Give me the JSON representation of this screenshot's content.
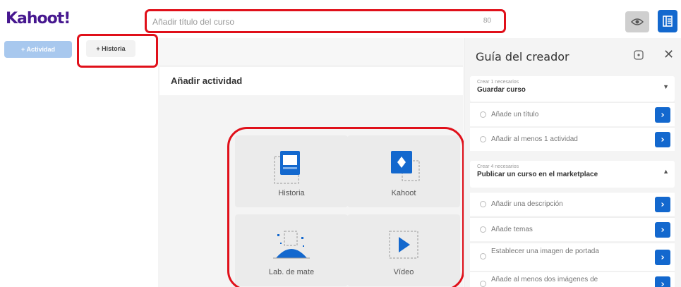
{
  "app": {
    "logo": "Kahoot!"
  },
  "header": {
    "title_placeholder": "Añadir título del curso",
    "title_counter": "80"
  },
  "left": {
    "activity_button": "+ Actividad",
    "story_button": "+ Historia"
  },
  "main": {
    "add_activity_title": "Añadir actividad",
    "tiles": [
      {
        "label": "Historia",
        "icon": "story-icon"
      },
      {
        "label": "Kahoot",
        "icon": "kahoot-icon"
      },
      {
        "label": "Lab. de mate",
        "icon": "math-lab-icon"
      },
      {
        "label": "Vídeo",
        "icon": "video-icon"
      }
    ]
  },
  "panel": {
    "title": "Guía del creador",
    "groups": [
      {
        "small": "Crear 1 necesarios",
        "title": "Guardar curso",
        "tasks": [
          "Añade un título",
          "Añadir al menos 1 actividad"
        ]
      },
      {
        "small": "Crear 4 necesarios",
        "title": "Publicar un curso en el marketplace",
        "tasks": [
          "Añadir una descripción",
          "Añade temas",
          "Establecer una imagen de portada",
          "Añade al menos dos imágenes de"
        ]
      }
    ]
  },
  "colors": {
    "brand": "#46178f",
    "accent_blue": "#1368ce",
    "highlight_red": "#e0101a"
  }
}
